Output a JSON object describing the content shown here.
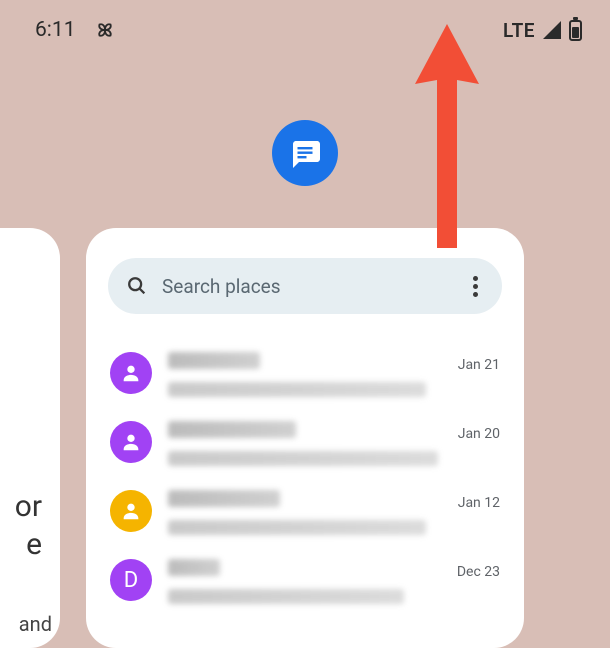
{
  "status": {
    "time": "6:11",
    "network": "LTE"
  },
  "search": {
    "placeholder": "Search places"
  },
  "conversations": [
    {
      "date": "Jan 21",
      "avatar_color": "purple",
      "avatar_letter": "",
      "name_width": 92,
      "preview_width": 258
    },
    {
      "date": "Jan 20",
      "avatar_color": "purple",
      "avatar_letter": "",
      "name_width": 128,
      "preview_width": 270
    },
    {
      "date": "Jan 12",
      "avatar_color": "yellow",
      "avatar_letter": "",
      "name_width": 112,
      "preview_width": 258
    },
    {
      "date": "Dec 23",
      "avatar_color": "purple-letter",
      "avatar_letter": "D",
      "name_width": 52,
      "preview_width": 236
    }
  ],
  "left_card": {
    "line1": "or",
    "line2": "e",
    "bottom": "and"
  }
}
